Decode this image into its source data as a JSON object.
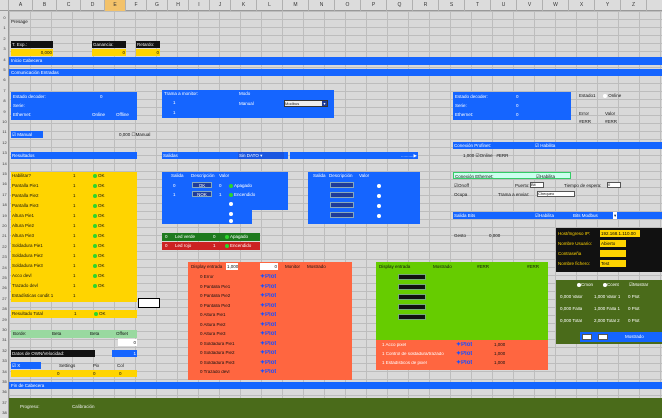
{
  "columns": [
    "A",
    "B",
    "C",
    "D",
    "E",
    "F",
    "G",
    "H",
    "I",
    "J",
    "K",
    "L",
    "M",
    "N",
    "O",
    "P",
    "Q",
    "R",
    "S",
    "T",
    "U",
    "V",
    "W",
    "X",
    "Y",
    "Z"
  ],
  "rows": [
    "0",
    "1",
    "2",
    "3",
    "4",
    "5",
    "6",
    "7",
    "8",
    "9",
    "10",
    "11",
    "12",
    "13",
    "14",
    "15",
    "16",
    "17",
    "18",
    "19",
    "20",
    "21",
    "22",
    "23",
    "24",
    "25",
    "26",
    "27",
    "28",
    "29",
    "30",
    "31",
    "32",
    "33",
    "34",
    "35",
    "36",
    "37",
    "38"
  ],
  "r0": "Presage",
  "texp_label": "T. Exp.:",
  "texp_val": "0,000",
  "ganancia_label": "Ganancia:",
  "ganancia_val": "0",
  "retardo_label": "Retardo:",
  "retardo_val": "0",
  "band_cabecera": "Inicio Cabecera",
  "band_comm": "Comunicación Entradas",
  "left_block": {
    "estado": "Estado decoder:",
    "estado_val": "0",
    "serie": "Serie:",
    "ethernet": "Ethernet:",
    "online": "Online",
    "offline": "Offline"
  },
  "trama": {
    "title": "Trama a monitor:",
    "modo": "Modo",
    "v1": "1",
    "v2": "1",
    "manual": "Manual",
    "combo": "Modbus"
  },
  "right_block": {
    "estado": "Estado decoder:",
    "estado_val": "0",
    "serie": "Serie:",
    "serie_val": "0",
    "ethernet": "Ethernet:",
    "ethernet_val": "0",
    "estado1": "Estado1",
    "online": "Online",
    "estado2": "Error",
    "valor": "Valor",
    "ferr1": "#ERR",
    "ferr2": "#ERR"
  },
  "manual_chk": "Manual",
  "chk_val": "0,000",
  "chk2": "Manual",
  "conexion_profinet": "Conexión Profinet:",
  "pn_val": "1,000",
  "pn_online": "Online",
  "pn_err": "#ERR",
  "resultados": "Resultados",
  "salidas": "Salidas",
  "sin_dato": "Sin DATO",
  "play": "..........▶",
  "conexion_ethernet": "Conexión Ethernet:",
  "habilita": "Habilita",
  "eth": {
    "onoff": "Onoff",
    "puerto": "Puerto:",
    "puerto_val": "Bit",
    "tiempo": "Tiempo de espera:",
    "tiempo_val": "0",
    "ocupa": "Ocupa",
    "trama_env": "Trama a enviar:",
    "trama_val": "Chequeo"
  },
  "results": [
    {
      "n": "Habilitar?",
      "v": "1",
      "s": "OK"
    },
    {
      "n": "Pantalla Pie1",
      "v": "1",
      "s": "OK"
    },
    {
      "n": "Pantalla Pie2",
      "v": "1",
      "s": "OK"
    },
    {
      "n": "Pantalla Pie3",
      "v": "1",
      "s": "OK"
    },
    {
      "n": "Altura Pie1",
      "v": "1",
      "s": "OK"
    },
    {
      "n": "Altura Pie2",
      "v": "1",
      "s": "OK"
    },
    {
      "n": "Altura Pie3",
      "v": "1",
      "s": "OK"
    },
    {
      "n": "Soldadura Pie1",
      "v": "1",
      "s": "OK"
    },
    {
      "n": "Soldadura Pie2",
      "v": "1",
      "s": "OK"
    },
    {
      "n": "Soldadura Pie3",
      "v": "1",
      "s": "OK"
    },
    {
      "n": "Acco devl",
      "v": "1",
      "s": "OK"
    },
    {
      "n": "Trazado devl",
      "v": "1",
      "s": "OK"
    },
    {
      "n": "Estadísticas condit 1",
      "v": "1",
      "s": ""
    }
  ],
  "result_total": {
    "n": "Resultado Total",
    "v": "1",
    "s": "OK"
  },
  "outs": {
    "salida": "Salida",
    "descripcion": "Descripción",
    "valor": "Valor",
    "row1": {
      "s": "0",
      "d": "OK",
      "v": "0",
      "st": "Apagado"
    },
    "row2": {
      "s": "1",
      "d": "NOK",
      "v": "1",
      "st": "Encendido"
    }
  },
  "outs2": {
    "salida": "Salida",
    "descripcion": "Descripción",
    "valor": "Valor"
  },
  "led_verde": {
    "n": "0",
    "d": "Led verde",
    "v": "0",
    "st": "Apagado"
  },
  "led_rojo": {
    "n": "0",
    "d": "Led rojo",
    "v": "1",
    "st": "Encendido"
  },
  "salida_bits": "Salida Bits",
  "habilita2": "Habilita",
  "gpio_val": "Bits",
  "gpio_combo": "Bits Modbus",
  "gesto": "Gesto",
  "gesto_val": "0,000",
  "net": {
    "ip": "Host/Ingreso IP:",
    "ip_val": "192.168.1.110.00",
    "usuario": "Nombre Usuario:",
    "usuario_val": "Abierto",
    "pass": "Contraseña",
    "pass_val": "",
    "fichero": "Nombre fichero:",
    "fichero_val": "Test"
  },
  "disp": {
    "title": "Display entrada",
    "val1": "1,000",
    "val2": "0",
    "monitor": "Monitor",
    "mostrado": "Mostrado"
  },
  "orange_rows": [
    "0 Error",
    "0 Pantalla Pie1",
    "0 Pantalla Pie2",
    "0 Pantalla Pie3",
    "0 Altura Pie1",
    "0 Altura Pie2",
    "0 Altura Pie3",
    "0 Soldadura Pie1",
    "0 Soldadura Pie2",
    "0 Soldadura Pie3",
    "0 Trazado devl"
  ],
  "plot": "Plot",
  "disp2": {
    "title": "Display entrada",
    "mostrado": "Mostrado",
    "err1": "#ERR",
    "err2": "#ERR"
  },
  "green_rows": [
    "1 Acco pixel",
    "1 Control de soldadura/trazado",
    "1 Estadísticos de pixel"
  ],
  "green_vals": [
    "1,000",
    "1,000",
    "1,000"
  ],
  "stats": {
    "cmon": "Cmon",
    "ccent": "Ccent",
    "mostrar": "Mostrar",
    "r1": [
      "0,000 Valor",
      "1,000 Valor 1",
      "0 Plot"
    ],
    "r2": [
      "0,000 Falla",
      "1,000 Falla 1",
      "0 Plot"
    ],
    "r3": [
      "0,000 Total",
      "2,000 Total 2",
      "0 Plot"
    ],
    "combo": "Mostrado"
  },
  "bottom": {
    "borde": "Borde:",
    "v1": "Beta",
    "v2": "Beta",
    "offset": "Offset",
    "offset_val": "0",
    "datos_label": "Datos de OWN/Velocidad:",
    "datos_val": "1",
    "x": "X",
    "x_val": "0",
    "settings": "Settings",
    "pix": "Pix",
    "pix_val": "0",
    "col": "Col",
    "col_val": "0"
  },
  "band_fin": "Fin de Cabecera",
  "progreso_label": "Progreso:",
  "progreso_val": "Calibración"
}
